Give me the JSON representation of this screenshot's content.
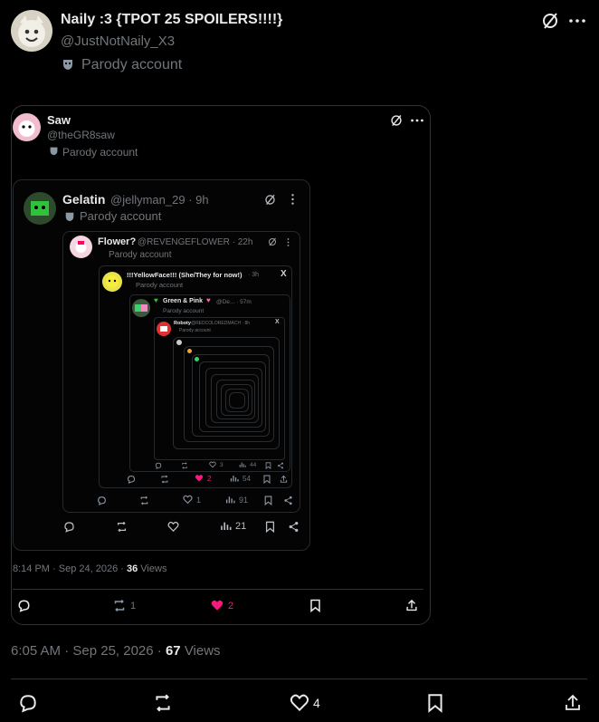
{
  "post": {
    "author_name": "Naily :3 {TPOT 25 SPOILERS!!!!}",
    "handle": "@JustNotNaily_X3",
    "label": "Parody account",
    "timestamp": "6:05 AM · Sep 25, 2026 ·",
    "views_count": "67",
    "views_label": "Views",
    "likes": "4"
  },
  "quote1": {
    "author_name": "Saw",
    "handle": "@theGR8saw",
    "label": "Parody account",
    "timestamp": "8:14 PM · Sep 24, 2026 ·",
    "views_count": "36",
    "views_label": "Views",
    "reposts": "1",
    "likes": "2"
  },
  "quote2": {
    "author_name": "Gelatin",
    "handle": "@jellyman_29 · 9h",
    "label": "Parody account",
    "views": "21"
  },
  "quote3": {
    "author_name": "Flower?",
    "handle": "@REVENGEFLOWER · 22h",
    "label": "Parody account",
    "likes": "1",
    "views": "91"
  },
  "quote4": {
    "author_name": "!!!YellowFace!!! (She/They for now!)",
    "handle": "· 3h",
    "label": "Parody account",
    "likes": "2",
    "views": "54"
  },
  "quote5": {
    "author_name": "Green & Pink",
    "handle": "@De... · 57m",
    "label": "Parody account",
    "replies": "3",
    "views": "44"
  },
  "quote6": {
    "author_name": "Roboty",
    "handle": "@REDCOLOREDMACH · 8h",
    "label": "Parody account"
  },
  "colors": {
    "background": "#000000",
    "like_pink": "#f91880",
    "muted_text": "#71767b"
  }
}
